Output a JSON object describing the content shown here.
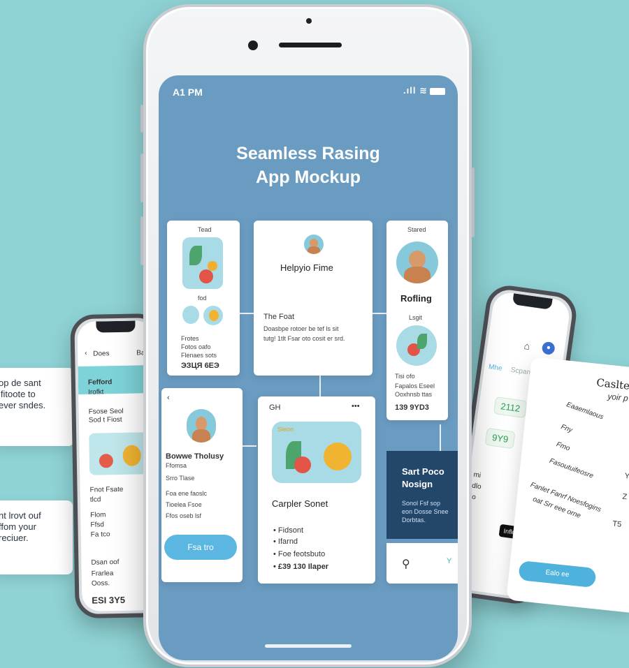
{
  "left_cards": {
    "card1": [
      "op de sant",
      "ifitoote to",
      "ever sndes."
    ],
    "card2": [
      "nt lrovt ouf",
      "ffom your",
      "reciuer."
    ]
  },
  "left_phone": {
    "back_label": "Does",
    "tab_label": "Bae",
    "header_title": "Fefford",
    "header_sub": "Irofkt",
    "lines": [
      "Fsose Seol",
      "Sod t Fiost",
      "Fnot Fsate",
      "tlcd",
      "Flom",
      "Ffsd",
      "Fa tco",
      "Dsan oof",
      "Frarlea",
      "Ooss."
    ],
    "footer": "ESI 3Y5"
  },
  "right_phone": {
    "tabs": [
      "Mhe",
      "Scpanas"
    ],
    "value1": "2112",
    "value2": "9Y9",
    "dark_tag": "Inflow",
    "labels": [
      "mi",
      "dlo",
      "lo"
    ]
  },
  "right_card": {
    "title": "Caslte F",
    "subtitle": "yoir p",
    "rows": [
      "Eaaemlaous",
      "Fny",
      "Fmo",
      "Fasoutuifeosre",
      "Fanlet Fanrf Noesfogins",
      "oat Srr eee orne"
    ],
    "amounts": [
      "Y",
      "Z",
      "Y",
      "T5"
    ],
    "button": "Ealo ee"
  },
  "main": {
    "status": {
      "time": "A1 PM",
      "icons": ".ıll ≋"
    },
    "title_line1": "Seamless Rasing",
    "title_line2": "App Mockup",
    "card_a": {
      "top": "Tead",
      "mid": "fod",
      "lines": [
        "Frotes",
        "Fotos oafo",
        "Flenaes sots"
      ],
      "bottom": "ЭЗЦЯ 6ЕЭ"
    },
    "card_b": {
      "title": "Helpyio Fime",
      "subtitle": "The Foat",
      "body": [
        "Doasbpe rotoer be tef ls sit",
        "tutg! 1tlt  Fsar oto cosit er srd."
      ]
    },
    "card_c": {
      "top": "Stared",
      "title": "Rofling",
      "mid": "Lsgit",
      "lines": [
        "Tisi ofo",
        "Fapalos Eseel",
        "Ooxhnsb ttas"
      ],
      "bottom": "139 9YD3"
    },
    "card_d": {
      "back": "‹",
      "name": "Bowwe Tholusy",
      "sub": "Ffomsa",
      "lines": [
        "Srro Tlase",
        "Foa ene faoslc",
        "Tioelea Fsoe",
        "Ffos oseb lsf"
      ],
      "button": "Fsa tro"
    },
    "card_e": {
      "menu_label": "GH",
      "dots": "•••",
      "title": "Carpler Sonet",
      "items": [
        "Fidsont",
        "Ifarnd",
        "Foe feotsbuto",
        "£39 130 Ilaper"
      ],
      "image_label": "Sleon"
    },
    "card_f": {
      "title_line1": "Sart Poco",
      "title_line2": "Nosign",
      "body": [
        "Sonol Fsf sop",
        "eon Dosse Snee",
        "Dorbtas."
      ],
      "search_hint": "Y"
    }
  }
}
